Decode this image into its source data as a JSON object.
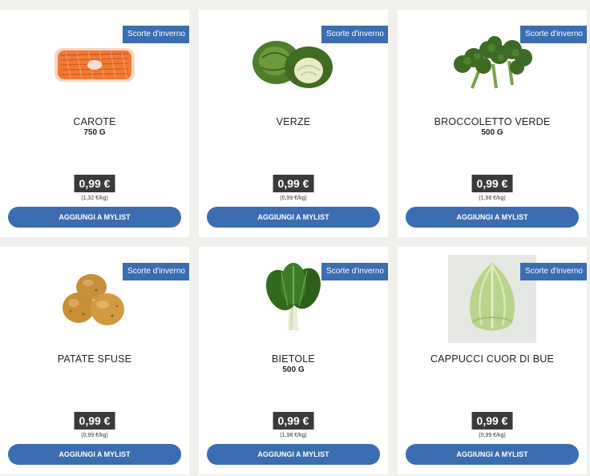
{
  "products": [
    {
      "name": "CAROTE",
      "weight": "750 G",
      "badge": "Scorte d'inverno",
      "price": "0,99 €",
      "unit_price": "(1,32 €/kg)",
      "button": "AGGIUNGI A MYLIST",
      "image": "carrots-image"
    },
    {
      "name": "VERZE",
      "weight": "",
      "badge": "Scorte d'inverno",
      "price": "0,99 €",
      "unit_price": "(0,99 €/kg)",
      "button": "AGGIUNGI A MYLIST",
      "image": "savoy-cabbage-image"
    },
    {
      "name": "BROCCOLETTO VERDE",
      "weight": "500 G",
      "badge": "Scorte d'inverno",
      "price": "0,99 €",
      "unit_price": "(1,98 €/kg)",
      "button": "AGGIUNGI A MYLIST",
      "image": "broccoli-image"
    },
    {
      "name": "PATATE SFUSE",
      "weight": "",
      "badge": "Scorte d'inverno",
      "price": "0,99 €",
      "unit_price": "(0,99 €/kg)",
      "button": "AGGIUNGI A MYLIST",
      "image": "potatoes-image"
    },
    {
      "name": "BIETOLE",
      "weight": "500 G",
      "badge": "Scorte d'inverno",
      "price": "0,99 €",
      "unit_price": "(1,98 €/kg)",
      "button": "AGGIUNGI A MYLIST",
      "image": "chard-image"
    },
    {
      "name": "CAPPUCCI CUOR DI BUE",
      "weight": "",
      "badge": "Scorte d'inverno",
      "price": "0,99 €",
      "unit_price": "(0,99 €/kg)",
      "button": "AGGIUNGI A MYLIST",
      "image": "pointed-cabbage-image"
    }
  ]
}
